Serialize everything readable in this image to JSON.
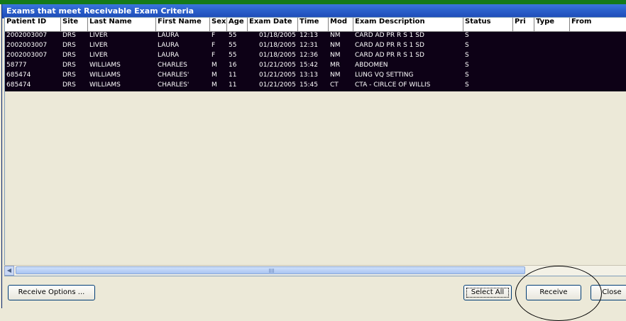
{
  "window": {
    "title": "Exams that meet Receivable Exam Criteria"
  },
  "table": {
    "columns": [
      "Patient ID",
      "Site",
      "Last Name",
      "First Name",
      "Sex",
      "Age",
      "Exam Date",
      "Time",
      "Mod",
      "Exam Description",
      "Status",
      "Pri",
      "Type",
      "From"
    ],
    "rows": [
      [
        "2002003007",
        "DRS",
        "LIVER",
        "LAURA",
        "F",
        "55",
        "01/18/2005",
        "12:13",
        "NM",
        "CARD AD PR R S 1 SD",
        "S",
        "",
        "",
        ""
      ],
      [
        "2002003007",
        "DRS",
        "LIVER",
        "LAURA",
        "F",
        "55",
        "01/18/2005",
        "12:31",
        "NM",
        "CARD AD PR R S 1 SD",
        "S",
        "",
        "",
        ""
      ],
      [
        "2002003007",
        "DRS",
        "LIVER",
        "LAURA",
        "F",
        "55",
        "01/18/2005",
        "12:36",
        "NM",
        "CARD AD PR R S 1 SD",
        "S",
        "",
        "",
        ""
      ],
      [
        "58777",
        "DRS",
        "WILLIAMS",
        "CHARLES",
        "M",
        "16",
        "01/21/2005",
        "15:42",
        "MR",
        "ABDOMEN",
        "S",
        "",
        "",
        ""
      ],
      [
        "685474",
        "DRS",
        "WILLIAMS",
        "CHARLES'",
        "M",
        "11",
        "01/21/2005",
        "13:13",
        "NM",
        "LUNG VQ SETTING",
        "S",
        "",
        "",
        ""
      ],
      [
        "685474",
        "DRS",
        "WILLIAMS",
        "CHARLES'",
        "M",
        "11",
        "01/21/2005",
        "15:45",
        "CT",
        "CTA - CIRLCE OF WILLIS",
        "S",
        "",
        "",
        ""
      ]
    ]
  },
  "buttons": {
    "receive_options": "Receive Options ...",
    "select_all": "Select All",
    "receive": "Receive",
    "close": "Close"
  },
  "icons": {
    "scroll_left": "scroll-left-arrow-icon"
  },
  "colors": {
    "selected_row_bg": "#0d0116",
    "title_bar": "#2a5fca",
    "annotation_circle": "#000000"
  }
}
